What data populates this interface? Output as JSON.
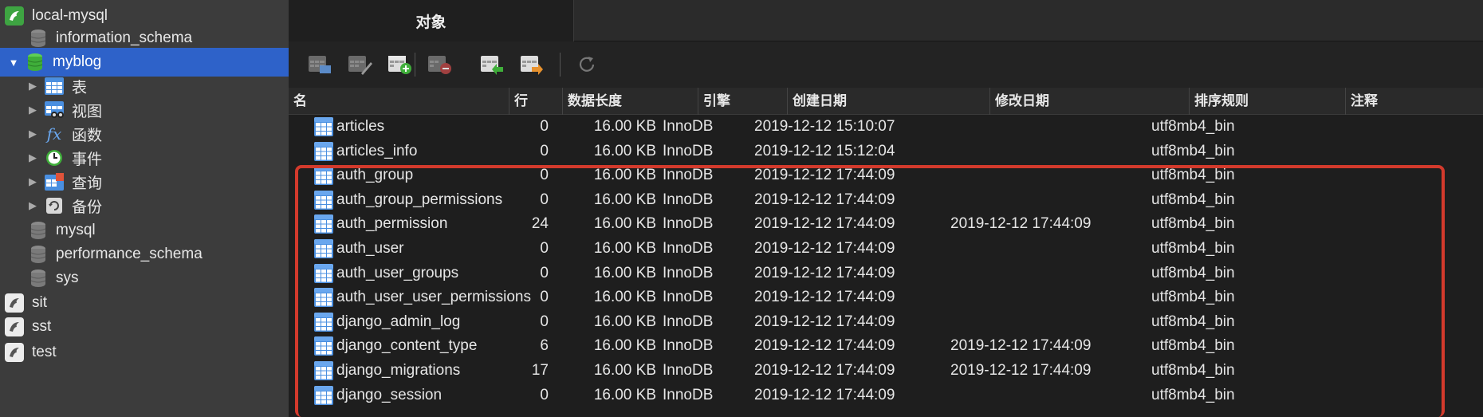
{
  "sidebar": {
    "items": [
      {
        "label": "local-mysql",
        "kind": "connection"
      },
      {
        "label": "information_schema",
        "kind": "database"
      },
      {
        "label": "myblog",
        "kind": "database"
      },
      {
        "label": "表",
        "kind": "group"
      },
      {
        "label": "视图",
        "kind": "group"
      },
      {
        "label": "函数",
        "kind": "group"
      },
      {
        "label": "事件",
        "kind": "group"
      },
      {
        "label": "查询",
        "kind": "group"
      },
      {
        "label": "备份",
        "kind": "group"
      },
      {
        "label": "mysql",
        "kind": "database"
      },
      {
        "label": "performance_schema",
        "kind": "database"
      },
      {
        "label": "sys",
        "kind": "database"
      },
      {
        "label": "sit",
        "kind": "connection"
      },
      {
        "label": "sst",
        "kind": "connection"
      },
      {
        "label": "test",
        "kind": "connection"
      }
    ],
    "selected": "myblog"
  },
  "tabs": [
    {
      "label": "对象"
    }
  ],
  "toolbar": {
    "buttons": [
      "open-table-icon",
      "design-table-icon",
      "new-table-icon",
      "delete-table-icon",
      "import-wizard-icon",
      "export-wizard-icon",
      "refresh-icon"
    ]
  },
  "table": {
    "columns": [
      "名",
      "行",
      "数据长度",
      "引擎",
      "创建日期",
      "修改日期",
      "排序规则",
      "注释"
    ],
    "rows": [
      {
        "name": "articles",
        "rows": "0",
        "size": "16.00 KB",
        "engine": "InnoDB",
        "created": "2019-12-12 15:10:07",
        "modified": "",
        "collation": "utf8mb4_bin"
      },
      {
        "name": "articles_info",
        "rows": "0",
        "size": "16.00 KB",
        "engine": "InnoDB",
        "created": "2019-12-12 15:12:04",
        "modified": "",
        "collation": "utf8mb4_bin"
      },
      {
        "name": "auth_group",
        "rows": "0",
        "size": "16.00 KB",
        "engine": "InnoDB",
        "created": "2019-12-12 17:44:09",
        "modified": "",
        "collation": "utf8mb4_bin"
      },
      {
        "name": "auth_group_permissions",
        "rows": "0",
        "size": "16.00 KB",
        "engine": "InnoDB",
        "created": "2019-12-12 17:44:09",
        "modified": "",
        "collation": "utf8mb4_bin"
      },
      {
        "name": "auth_permission",
        "rows": "24",
        "size": "16.00 KB",
        "engine": "InnoDB",
        "created": "2019-12-12 17:44:09",
        "modified": "2019-12-12 17:44:09",
        "collation": "utf8mb4_bin"
      },
      {
        "name": "auth_user",
        "rows": "0",
        "size": "16.00 KB",
        "engine": "InnoDB",
        "created": "2019-12-12 17:44:09",
        "modified": "",
        "collation": "utf8mb4_bin"
      },
      {
        "name": "auth_user_groups",
        "rows": "0",
        "size": "16.00 KB",
        "engine": "InnoDB",
        "created": "2019-12-12 17:44:09",
        "modified": "",
        "collation": "utf8mb4_bin"
      },
      {
        "name": "auth_user_user_permissions",
        "rows": "0",
        "size": "16.00 KB",
        "engine": "InnoDB",
        "created": "2019-12-12 17:44:09",
        "modified": "",
        "collation": "utf8mb4_bin"
      },
      {
        "name": "django_admin_log",
        "rows": "0",
        "size": "16.00 KB",
        "engine": "InnoDB",
        "created": "2019-12-12 17:44:09",
        "modified": "",
        "collation": "utf8mb4_bin"
      },
      {
        "name": "django_content_type",
        "rows": "6",
        "size": "16.00 KB",
        "engine": "InnoDB",
        "created": "2019-12-12 17:44:09",
        "modified": "2019-12-12 17:44:09",
        "collation": "utf8mb4_bin"
      },
      {
        "name": "django_migrations",
        "rows": "17",
        "size": "16.00 KB",
        "engine": "InnoDB",
        "created": "2019-12-12 17:44:09",
        "modified": "2019-12-12 17:44:09",
        "collation": "utf8mb4_bin"
      },
      {
        "name": "django_session",
        "rows": "0",
        "size": "16.00 KB",
        "engine": "InnoDB",
        "created": "2019-12-12 17:44:09",
        "modified": "",
        "collation": "utf8mb4_bin"
      }
    ]
  },
  "colors": {
    "selection": "#2e62c9",
    "highlight_box": "#d33a2c",
    "table_icon": "#4a8fe0",
    "connection_active": "#3ea442"
  }
}
